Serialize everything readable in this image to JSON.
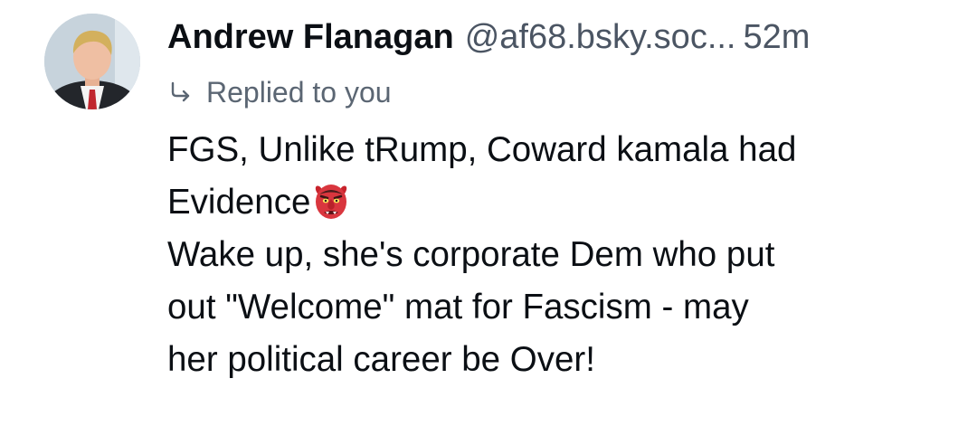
{
  "post": {
    "author": {
      "display_name": "Andrew Flanagan",
      "handle": "@af68.bsky.soc...",
      "time": "52m"
    },
    "reply_context": {
      "icon": "reply-arrow-icon",
      "label": "Replied to you"
    },
    "body": {
      "line1": "FGS, Unlike tRump, Coward kamala had",
      "line2": "Evidence",
      "line2_emoji": "goblin-face-emoji",
      "line3": "Wake up, she's corporate Dem who put",
      "line4": "out \"Welcome\" mat for Fascism - may",
      "line5": "her political career be Over!"
    }
  },
  "colors": {
    "text_primary": "#0b0f14",
    "text_secondary": "#4b5563",
    "background": "#ffffff"
  }
}
